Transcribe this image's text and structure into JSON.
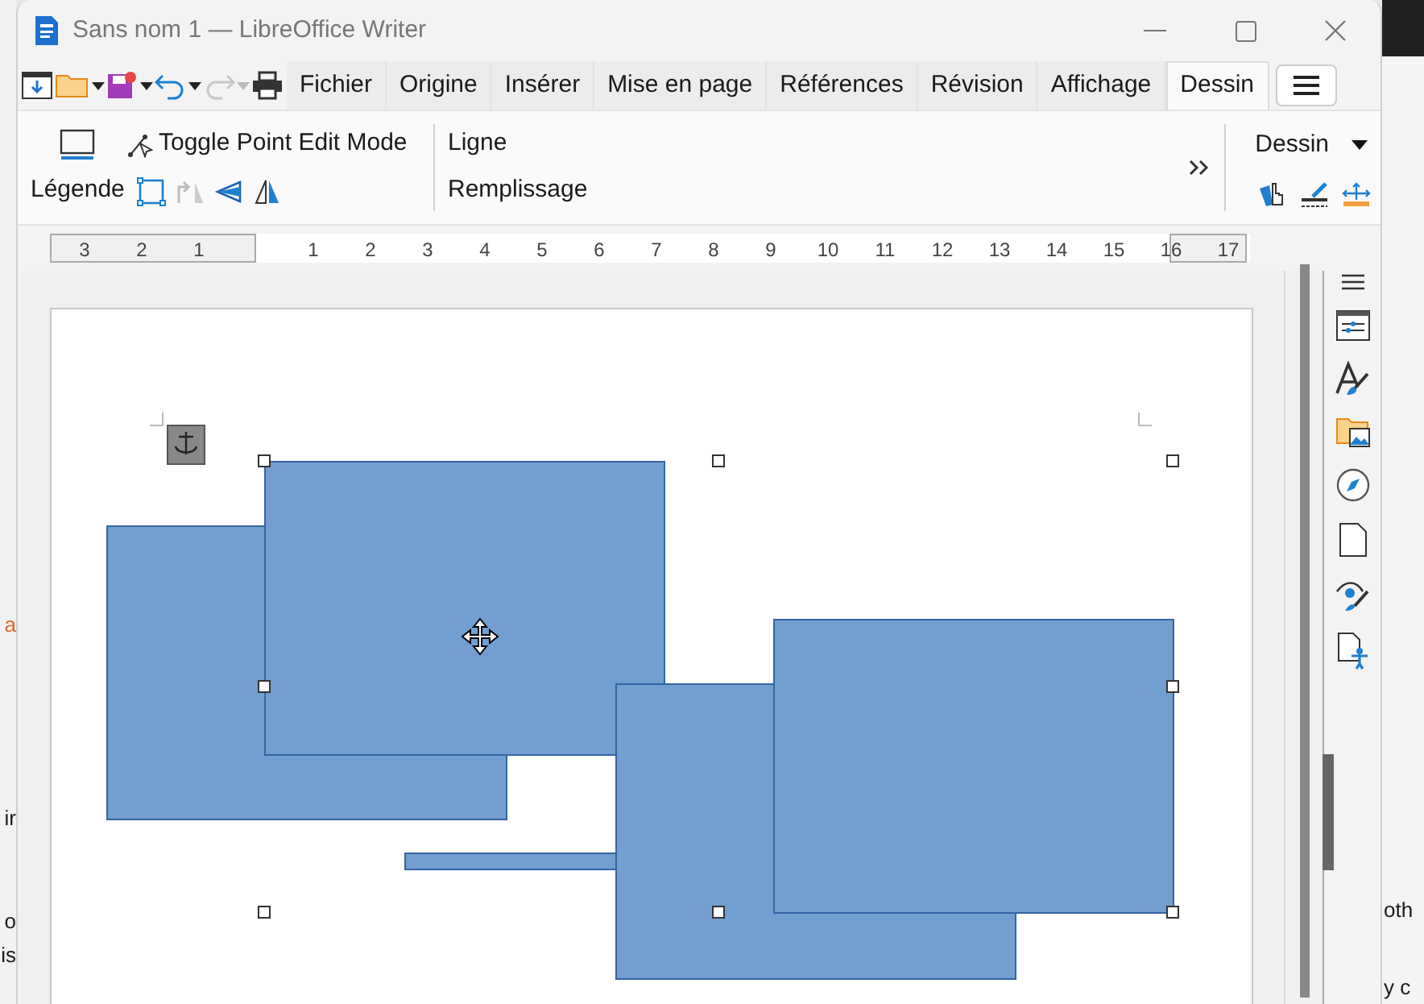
{
  "window": {
    "title": "Sans nom 1 — LibreOffice Writer"
  },
  "tabs": [
    {
      "label": "Fichier",
      "selected": false
    },
    {
      "label": "Origine",
      "selected": false
    },
    {
      "label": "Insérer",
      "selected": false
    },
    {
      "label": "Mise en page",
      "selected": false
    },
    {
      "label": "Références",
      "selected": false
    },
    {
      "label": "Révision",
      "selected": false
    },
    {
      "label": "Affichage",
      "selected": false
    },
    {
      "label": "Dessin",
      "selected": true
    }
  ],
  "ribbon": {
    "toggle_point_edit": "Toggle Point Edit Mode",
    "legend": "Légende",
    "line": "Ligne",
    "fill": "Remplissage",
    "group_menu": "Dessin"
  },
  "ruler": {
    "left_labels": [
      "3",
      "2",
      "1"
    ],
    "right_labels": [
      "1",
      "2",
      "3",
      "4",
      "5",
      "6",
      "7",
      "8",
      "9",
      "10",
      "11",
      "12",
      "13",
      "14",
      "15",
      "16",
      "17"
    ]
  },
  "background": {
    "left_texts": [
      "a",
      "ir",
      "o",
      "is"
    ],
    "right_texts": [
      "oth",
      "y c"
    ]
  }
}
